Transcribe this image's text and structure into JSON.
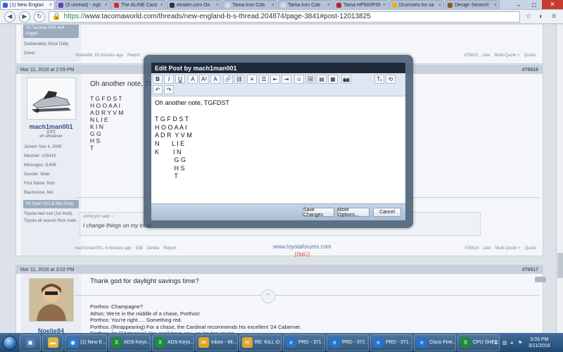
{
  "browser": {
    "tabs": [
      {
        "label": "(1) New Englan",
        "active": true,
        "favicon_color": "#2e68c7"
      },
      {
        "label": "(5 unread) - mjd",
        "active": false,
        "favicon_color": "#6a3ab5"
      },
      {
        "label": "The ALINE Card",
        "active": false,
        "favicon_color": "#d0302b"
      },
      {
        "label": "etrailer.com On",
        "active": false,
        "favicon_color": "#333333"
      },
      {
        "label": "Tama Iron Cob",
        "active": false,
        "favicon_color": "#d8d8d8"
      },
      {
        "label": "Tama Iron Cob",
        "active": false,
        "favicon_color": "#d8d8d8"
      },
      {
        "label": "Tama HP900PSN",
        "active": false,
        "favicon_color": "#b02525"
      },
      {
        "label": "Drumsets for sa",
        "active": false,
        "favicon_color": "#e7b417"
      },
      {
        "label": "Design Series®",
        "active": false,
        "favicon_color": "#8a5a2a"
      }
    ],
    "window_controls": {
      "minimize": "–",
      "maximize": "□",
      "close": "✕"
    },
    "url_scheme": "https://",
    "url_host": "www.tacomaworld.com",
    "url_path": "/threads/new-england-b-s-thread.204874/page-3841#post-12013825",
    "nav": {
      "back": "◀",
      "forward": "▶",
      "refresh": "↻"
    },
    "icons": [
      "star-icon",
      "extension-icon",
      "menu-icon"
    ]
  },
  "prev_post": {
    "signature_label": "'10 Tacoma SR5 4x4 (Agge)",
    "signature_text": "Deliberately Stock Daily Driver",
    "author_line": "Noelie84, 33 minutes ago",
    "report": "Report",
    "number": "#76815",
    "like": "Like",
    "multi_quote": "Multi-Quote +",
    "quote": "Quote"
  },
  "post": {
    "date": "Mar 11, 2016 at 2:59 PM",
    "number": "#76816",
    "username": "mach1man001",
    "role": "[OP]",
    "title": "eh whatever",
    "info": [
      "Joined: Nov 4, 2009",
      "Member: #25415",
      "Messages: 8,646",
      "Gender: Male",
      "First Name: Rob",
      "Blackstone, MA"
    ],
    "vehicle_badge": "'09 Sport DCLB Met Grey",
    "vehicle_text": "Toyota bed mat (1st mod), Toyota all season floor mats.",
    "message_first_line": "Oh another note, TGFDST",
    "message_lines": [
      "T G F D S T",
      "H O O A A I",
      "A D R Y V M",
      "N L I E",
      "K I N",
      "G G",
      "H S",
      "T"
    ],
    "quote_author": "Johnnym said: ↑",
    "quote_text": "I change things on my truck",
    "sig_link": "www.toyotaforums.com",
    "sig_img": "[IMG]",
    "footer_author": "mach1man001, 4 minutes ago",
    "edit": "Edit",
    "delete": "Delete",
    "report": "Report",
    "like": "Like",
    "multi_quote": "Multi-Quote +",
    "quote": "Quote"
  },
  "next_post": {
    "date": "Mar 11, 2016 at 3:02 PM",
    "number": "#76817",
    "username": "Noelie84",
    "title": "Thank god for daylight savings time?",
    "lines": [
      "Porthos: Champagne?",
      "Athos: We're in the middle of a chase, Porthos!",
      "Porthos: You're right..... Something red.",
      "Porthos: (Reappearing) For a chase, the Cardinal recommends his excellent '24 Cabernet.",
      "Porthos: (to D'Artagnan) You can't have any, you're too young."
    ]
  },
  "modal": {
    "title": "Edit Post by mach1man001",
    "toolbar_row1": [
      "B",
      "I",
      "U",
      "A",
      "A²",
      "A",
      "🔗",
      "⛓",
      "≡",
      "☰",
      "⇤",
      "⇥",
      "☺",
      "🖼",
      "▤",
      "▦",
      "📷",
      "Tₓ",
      "⟲"
    ],
    "toolbar_row2": [
      "↶",
      "↷"
    ],
    "editor_text": "Oh another note, TGFDST\n\nT G F D S T\nH O O A A I\nA D R  Y V M\nN       L I E\nK        I N\n           G G\n           H S\n           T",
    "save_label": "Save Changes",
    "more_label": "More Options...",
    "cancel_label": "Cancel"
  },
  "taskbar": {
    "items": [
      {
        "label": "",
        "color": "#4b78b0",
        "glyph": "▣",
        "pinned": true
      },
      {
        "label": "",
        "color": "#e1b73f",
        "glyph": "▬",
        "pinned": true
      },
      {
        "label": "(1) New E...",
        "color": "#2f79c8",
        "glyph": "◉",
        "pinned": false
      },
      {
        "label": "ADS-Keys...",
        "color": "#1f8a3b",
        "glyph": "X",
        "pinned": false
      },
      {
        "label": "ADS-Keys...",
        "color": "#1f8a3b",
        "glyph": "X",
        "pinned": false
      },
      {
        "label": "Inbox - Mi...",
        "color": "#e0a52b",
        "glyph": "✉",
        "pinned": false
      },
      {
        "label": "RE: KILL O...",
        "color": "#e0a52b",
        "glyph": "✉",
        "pinned": false
      },
      {
        "label": "PRD - 371 ...",
        "color": "#2a72c8",
        "glyph": "e",
        "pinned": false
      },
      {
        "label": "PRD - 371 ...",
        "color": "#2a72c8",
        "glyph": "e",
        "pinned": false
      },
      {
        "label": "PRD - 371 ...",
        "color": "#2a72c8",
        "glyph": "e",
        "pinned": false
      },
      {
        "label": "Cisco Fine...",
        "color": "#2a72c8",
        "glyph": "e",
        "pinned": false
      },
      {
        "label": "CPU SHEE...",
        "color": "#1f8a3b",
        "glyph": "X",
        "pinned": false
      }
    ],
    "time": "3:03 PM",
    "date": "3/11/2016"
  }
}
